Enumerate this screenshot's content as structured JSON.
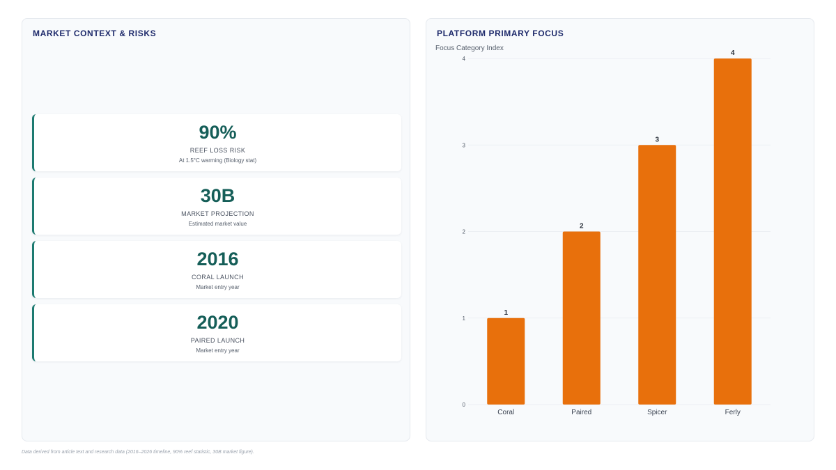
{
  "left_panel": {
    "title": "MARKET CONTEXT & RISKS",
    "stats": [
      {
        "value": "90%",
        "label": "REEF LOSS RISK",
        "note": "At 1.5°C warming (Biology stat)"
      },
      {
        "value": "30B",
        "label": "MARKET PROJECTION",
        "note": "Estimated market value"
      },
      {
        "value": "2016",
        "label": "CORAL LAUNCH",
        "note": "Market entry year"
      },
      {
        "value": "2020",
        "label": "PAIRED LAUNCH",
        "note": "Market entry year"
      }
    ]
  },
  "right_panel": {
    "title": "PLATFORM PRIMARY FOCUS"
  },
  "chart_data": {
    "type": "bar",
    "title": "PLATFORM PRIMARY FOCUS",
    "ylabel": "Focus Category Index",
    "xlabel": "",
    "categories": [
      "Coral",
      "Paired",
      "Spicer",
      "Ferly"
    ],
    "values": [
      1,
      2,
      3,
      4
    ],
    "ylim": [
      0,
      4
    ],
    "yticks": [
      0,
      1,
      2,
      3,
      4
    ],
    "data_labels": true,
    "grid": true,
    "bar_color": "#e8700c"
  },
  "footnote": "Data derived from article text and research data (2016–2026 timeline, 90% reef statistic, 30B market figure)."
}
